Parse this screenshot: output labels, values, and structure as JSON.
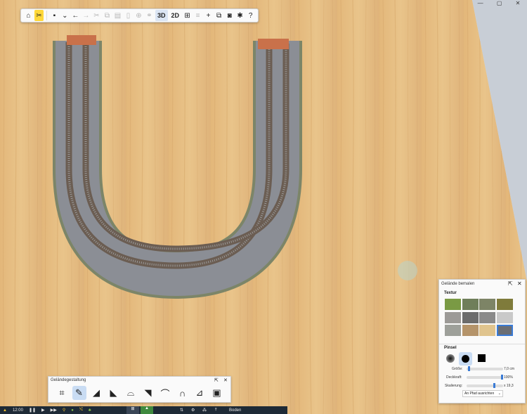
{
  "window": {
    "minimize_icon": "minimize-icon",
    "maximize_icon": "maximize-icon",
    "close_icon": "close-icon"
  },
  "toolbar": {
    "items": [
      {
        "name": "home-icon",
        "glyph": "⌂"
      },
      {
        "name": "tools-icon",
        "glyph": "✂"
      },
      {
        "name": "save-icon",
        "glyph": "▪"
      },
      {
        "name": "undo-icon",
        "glyph": "←"
      },
      {
        "name": "redo-icon",
        "glyph": "→"
      },
      {
        "name": "3d-label",
        "glyph": "3D"
      },
      {
        "name": "2d-label",
        "glyph": "2D"
      },
      {
        "name": "add-icon",
        "glyph": "+"
      },
      {
        "name": "camera-icon",
        "glyph": "◙"
      },
      {
        "name": "plugin-icon",
        "glyph": "✱"
      },
      {
        "name": "help-icon",
        "glyph": "?"
      }
    ],
    "view_3d": "3D",
    "view_2d": "2D"
  },
  "paint_panel": {
    "title": "Gelände bemalen",
    "texture_heading": "Textur",
    "brush_heading": "Pinsel",
    "size_label": "Größe:",
    "size_value": "7,0 cm",
    "opacity_label": "Deckkraft:",
    "opacity_value": "100%",
    "scale_label": "Skalierung:",
    "scale_value": "x 19,3",
    "align_button": "An Pfad ausrichten",
    "textures": [
      "#7a9a44",
      "#6f7e5a",
      "#7d8466",
      "#7f7b3b",
      "#9c9a97",
      "#6c6c6c",
      "#8a8a8a",
      "#c9c9c9",
      "#9ea09a",
      "#b5946a",
      "#e0c48e",
      "#6b6e74"
    ],
    "selected_texture_index": 11,
    "size_fraction": 0.05,
    "opacity_fraction": 1.0,
    "scale_fraction": 0.78
  },
  "terrain_panel": {
    "title": "Geländegestaltung",
    "tools": [
      "shape-terrain-icon",
      "paint-brush-icon",
      "raise-terrain-icon",
      "lower-terrain-icon",
      "flatten-terrain-icon",
      "smooth-terrain-icon",
      "hill-icon",
      "tunnel-portal-icon",
      "add-slope-icon",
      "terrain-library-icon"
    ],
    "selected_tool_index": 1
  },
  "status": {
    "time": "12:00",
    "layer": "Boden"
  }
}
